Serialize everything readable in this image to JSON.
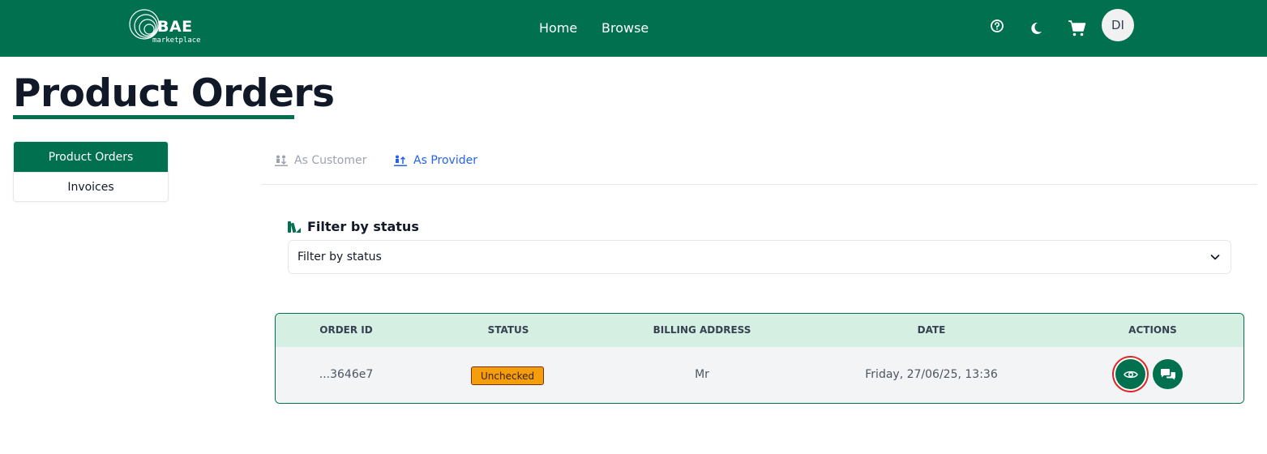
{
  "header": {
    "logo_text": "BAE",
    "logo_subtext": "marketplace",
    "nav": [
      {
        "label": "Home"
      },
      {
        "label": "Browse"
      }
    ],
    "icons": [
      "help-icon",
      "moon-icon",
      "cart-icon"
    ],
    "avatar_initials": "DI"
  },
  "page": {
    "title": "Product Orders"
  },
  "side_menu": {
    "items": [
      {
        "label": "Product Orders",
        "active": true
      },
      {
        "label": "Invoices",
        "active": false
      }
    ]
  },
  "tabs": [
    {
      "label": "As Customer",
      "icon": "customer-icon",
      "active": false
    },
    {
      "label": "As Provider",
      "icon": "provider-icon",
      "active": true
    }
  ],
  "filter": {
    "label": "Filter by status",
    "select_value": "Filter by status"
  },
  "orders_table": {
    "headers": [
      "ORDER ID",
      "STATUS",
      "BILLING ADDRESS",
      "DATE",
      "ACTIONS"
    ],
    "rows": [
      {
        "order_id": "...3646e7",
        "status": "Unchecked",
        "billing_address": "Mr",
        "date": "Friday, 27/06/25, 13:36",
        "actions": [
          "view-icon",
          "chat-icon"
        ]
      }
    ]
  },
  "colors": {
    "brand": "#00704f",
    "table_header_bg": "#d5efe2",
    "status_unchecked": "#f59e0b",
    "active_tab": "#2563eb",
    "focus_ring": "#dc2626"
  }
}
